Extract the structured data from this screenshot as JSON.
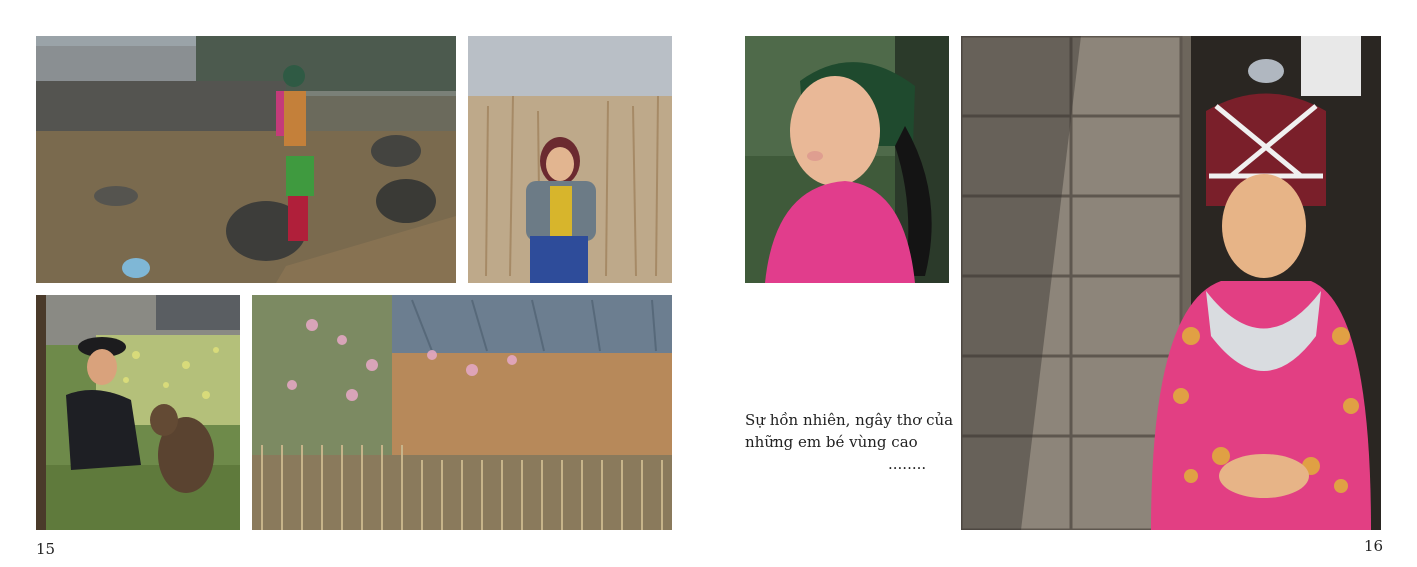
{
  "pages": {
    "left_number": "15",
    "right_number": "16"
  },
  "caption": {
    "line1": "Sự hồn nhiên, ngây thơ của",
    "line2": "những em bé vùng cao",
    "line3": "........"
  },
  "colors": {
    "background": "#ffffff",
    "text": "#222222"
  }
}
